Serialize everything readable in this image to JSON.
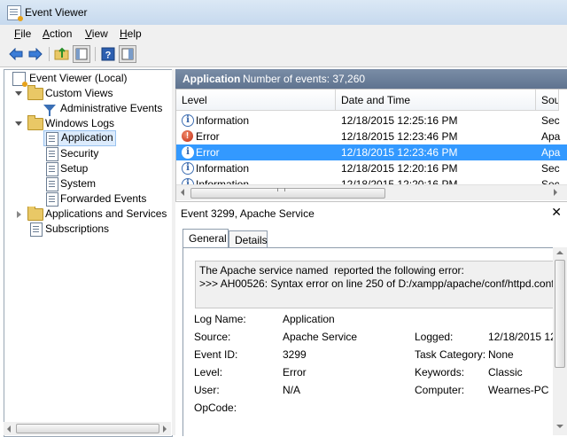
{
  "window": {
    "title": "Event Viewer"
  },
  "menu": {
    "items": [
      {
        "label": "File",
        "accel": "F",
        "rest": "ile"
      },
      {
        "label": "Action",
        "accel": "A",
        "rest": "ction"
      },
      {
        "label": "View",
        "accel": "V",
        "rest": "iew"
      },
      {
        "label": "Help",
        "accel": "H",
        "rest": "elp"
      }
    ]
  },
  "toolbar": {
    "icons": [
      "back-arrow-icon",
      "forward-arrow-icon",
      "folder-up-icon",
      "show-hide-tree-icon",
      "help-icon",
      "show-hide-action-pane-icon"
    ]
  },
  "tree": {
    "root": "Event Viewer (Local)",
    "custom_views": "Custom Views",
    "administrative_events": "Administrative Events",
    "windows_logs": "Windows Logs",
    "logs": [
      "Application",
      "Security",
      "Setup",
      "System",
      "Forwarded Events"
    ],
    "apps_services": "Applications and Services Lo",
    "subscriptions": "Subscriptions",
    "selected": "Application"
  },
  "log_header": {
    "title": "Application",
    "count_text": "Number of events: 37,260"
  },
  "grid": {
    "columns": [
      "Level",
      "Date and Time",
      "Sou"
    ],
    "rows": [
      {
        "level": "Information",
        "icon": "info",
        "datetime": "12/18/2015 12:25:16 PM",
        "source": "Sec"
      },
      {
        "level": "Error",
        "icon": "error",
        "datetime": "12/18/2015 12:23:46 PM",
        "source": "Apa"
      },
      {
        "level": "Error",
        "icon": "error",
        "datetime": "12/18/2015 12:23:46 PM",
        "source": "Apa",
        "selected": true
      },
      {
        "level": "Information",
        "icon": "info",
        "datetime": "12/18/2015 12:20:16 PM",
        "source": "Sec"
      },
      {
        "level": "Information",
        "icon": "info",
        "datetime": "12/18/2015 12:20:16 PM",
        "source": "Sec"
      }
    ]
  },
  "detail": {
    "title": "Event 3299, Apache Service",
    "tabs": [
      "General",
      "Details"
    ],
    "active_tab": "General",
    "message_line1": "The Apache service named  reported the following error:",
    "message_line2": ">>> AH00526: Syntax error on line 250 of D:/xampp/apache/conf/httpd.conf:",
    "props": {
      "log_name_label": "Log Name:",
      "log_name": "Application",
      "source_label": "Source:",
      "source": "Apache Service",
      "logged_label": "Logged:",
      "logged": "12/18/2015 12",
      "event_id_label": "Event ID:",
      "event_id": "3299",
      "task_category_label": "Task Category:",
      "task_category": "None",
      "level_label": "Level:",
      "level": "Error",
      "keywords_label": "Keywords:",
      "keywords": "Classic",
      "user_label": "User:",
      "user": "N/A",
      "computer_label": "Computer:",
      "computer": "Wearnes-PC",
      "opcode_label": "OpCode:"
    }
  },
  "colors": {
    "selection": "#3399ff",
    "header_bar": "#6b7f9a",
    "error_red": "#c22a12",
    "info_blue": "#2f5fa5"
  }
}
